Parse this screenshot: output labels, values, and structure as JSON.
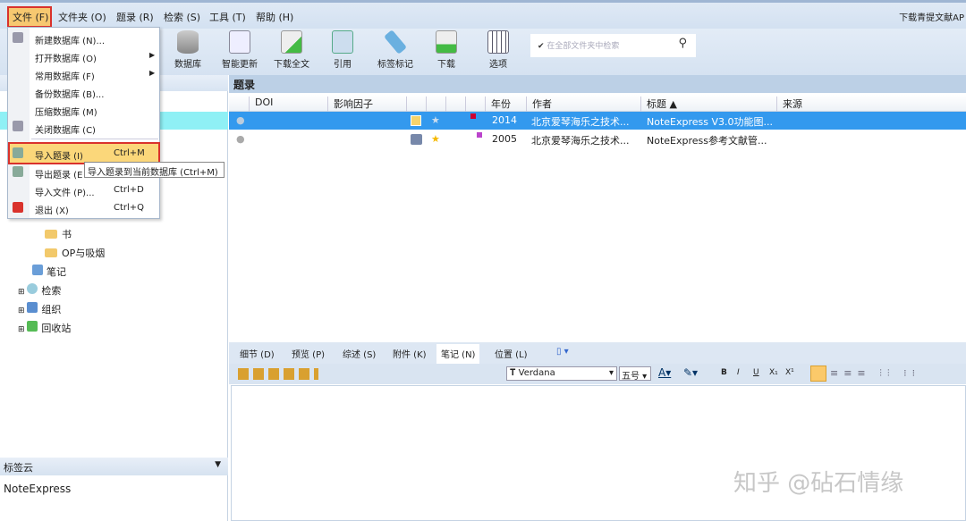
{
  "menubar": {
    "items": [
      "文件 (F)",
      "文件夹 (O)",
      "题录 (R)",
      "检索 (S)",
      "工具 (T)",
      "帮助 (H)"
    ],
    "right_text": "下载青提文献AP"
  },
  "toolbar": {
    "buttons": [
      "数据库",
      "智能更新",
      "下载全文",
      "引用",
      "标签标记",
      "下载",
      "选项"
    ],
    "search_placeholder": "在全部文件夹中检索"
  },
  "file_menu": {
    "items": [
      {
        "label": "新建数据库 (N)...",
        "shortcut": ""
      },
      {
        "label": "打开数据库 (O)",
        "shortcut": ""
      },
      {
        "label": "常用数据库 (F)",
        "shortcut": ""
      },
      {
        "label": "备份数据库 (B)...",
        "shortcut": ""
      },
      {
        "label": "压缩数据库 (M)",
        "shortcut": ""
      },
      {
        "label": "关闭数据库 (C)",
        "shortcut": ""
      },
      {
        "label": "导入题录 (I)",
        "shortcut": "Ctrl+M"
      },
      {
        "label": "导出题录 (E",
        "shortcut": ""
      },
      {
        "label": "导入文件 (P)...",
        "shortcut": "Ctrl+D"
      },
      {
        "label": "退出 (X)",
        "shortcut": "Ctrl+Q"
      }
    ],
    "tooltip": "导入题录到当前数据库 (Ctrl+M)"
  },
  "tree": {
    "items": [
      "书",
      "OP与吸烟",
      "笔记",
      "检索",
      "组织",
      "回收站"
    ]
  },
  "tag_cloud": {
    "title": "标签云",
    "content": "NoteExpress"
  },
  "records": {
    "title": "题录",
    "columns": [
      "DOI",
      "影响因子",
      "年份",
      "作者",
      "标题 ▲",
      "来源"
    ],
    "rows": [
      {
        "year": "2014",
        "author": "北京爱琴海乐之技术...",
        "title": "NoteExpress V3.0功能图...",
        "source": ""
      },
      {
        "year": "2005",
        "author": "北京爱琴海乐之技术...",
        "title": "NoteExpress参考文献管...",
        "source": ""
      }
    ]
  },
  "detail_tabs": [
    "细节 (D)",
    "预览 (P)",
    "综述 (S)",
    "附件 (K)",
    "笔记 (N)",
    "位置 (L)"
  ],
  "format": {
    "font": "Verdana",
    "size": "五号",
    "buttons": [
      "B",
      "I",
      "U",
      "X₁",
      "X¹"
    ]
  },
  "watermark": "知乎 @砧石情缘",
  "colors": {
    "selected": "#3399ee",
    "highlight": "#fbd77a",
    "red": "#d9322c"
  }
}
